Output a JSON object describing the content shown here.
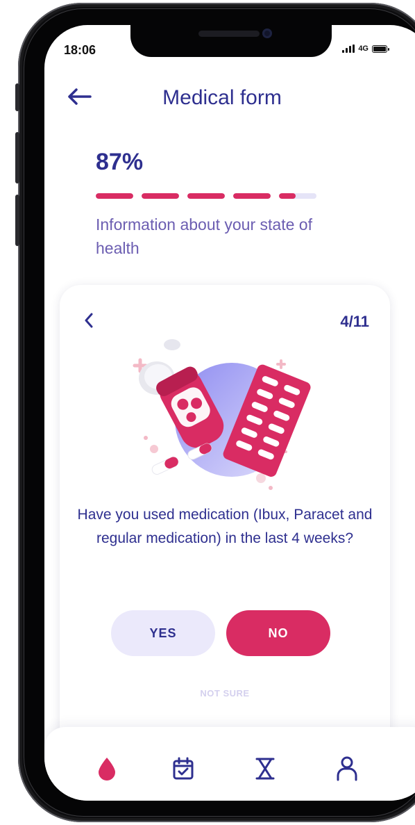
{
  "status_bar": {
    "time": "18:06",
    "network": "4G"
  },
  "header": {
    "title": "Medical form"
  },
  "progress": {
    "percent_label": "87%",
    "segment_fill": [
      1,
      1,
      1,
      1,
      0.45
    ],
    "subtitle": "Information about your state of health"
  },
  "card": {
    "counter": "4/11",
    "question": "Have you used medication (Ibux, Paracet and regular medication) in the last 4 weeks?",
    "yes_label": "YES",
    "no_label": "NO",
    "not_sure_label": "NOT SURE"
  },
  "tabs": [
    {
      "icon": "drop-icon",
      "active": true
    },
    {
      "icon": "calendar-check-icon",
      "active": false
    },
    {
      "icon": "hourglass-icon",
      "active": false
    },
    {
      "icon": "user-icon",
      "active": false
    }
  ],
  "colors": {
    "primary_text": "#2e2f8f",
    "accent": "#d92c63",
    "secondary_text": "#6b5db1",
    "soft_button": "#ebe9fb"
  }
}
